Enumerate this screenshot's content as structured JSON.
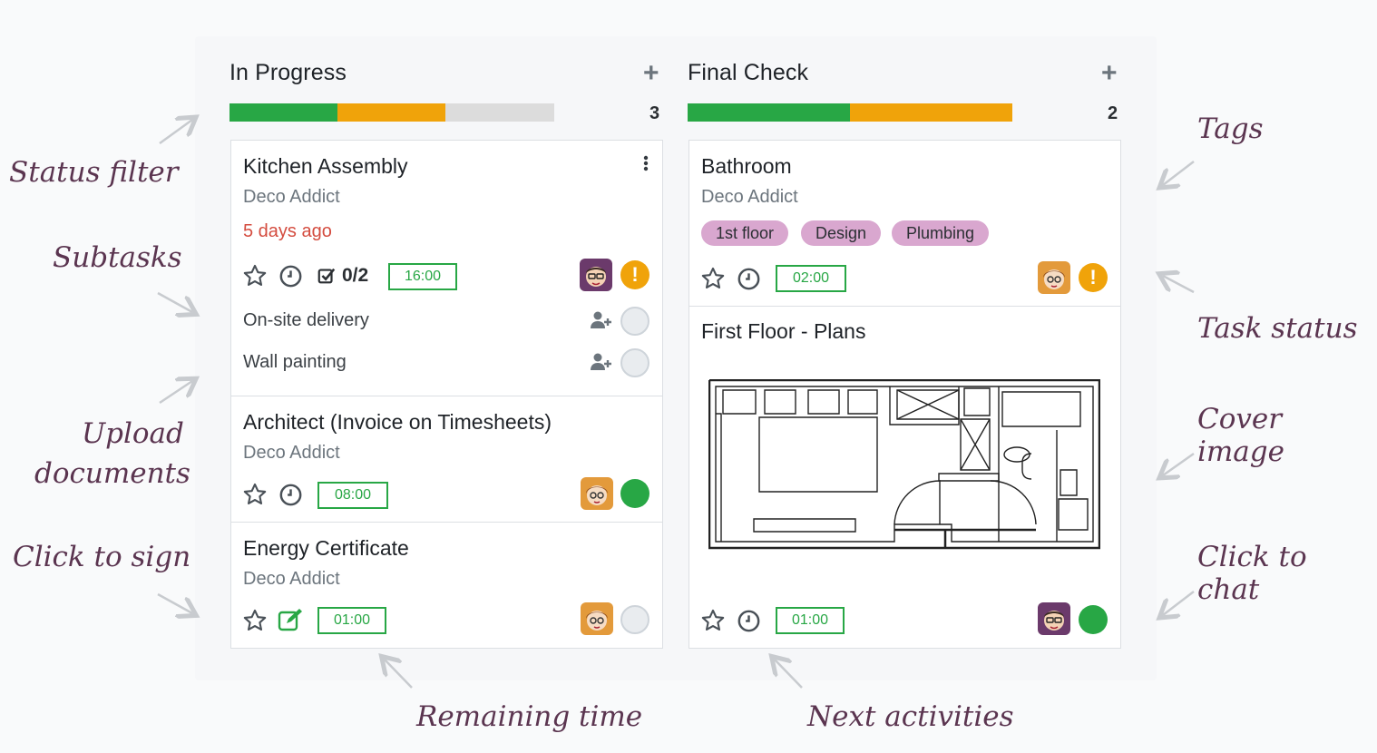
{
  "columns": [
    {
      "title": "In Progress",
      "add_label": "+",
      "count": "3",
      "progress": [
        {
          "color": "#28a745",
          "share": 0.333
        },
        {
          "color": "#f0a30a",
          "share": 0.333
        },
        {
          "color": "#dcdcdc",
          "share": 0.334
        }
      ]
    },
    {
      "title": "Final Check",
      "add_label": "+",
      "count": "2",
      "progress": [
        {
          "color": "#28a745",
          "share": 0.5
        },
        {
          "color": "#f0a30a",
          "share": 0.5
        }
      ]
    }
  ],
  "cards": {
    "kitchen": {
      "title": "Kitchen Assembly",
      "customer": "Deco Addict",
      "deadline": "5 days ago",
      "subtasks_count": "0/2",
      "time": "16:00",
      "status": "warning",
      "subtasks": [
        "On-site delivery",
        "Wall painting"
      ]
    },
    "architect": {
      "title": "Architect (Invoice on Timesheets)",
      "customer": "Deco Addict",
      "time": "08:00",
      "status": "done"
    },
    "energy": {
      "title": "Energy Certificate",
      "customer": "Deco Addict",
      "time": "01:00",
      "status": "normal"
    },
    "bathroom": {
      "title": "Bathroom",
      "customer": "Deco Addict",
      "tags": [
        "1st floor",
        "Design",
        "Plumbing"
      ],
      "time": "02:00",
      "status": "warning"
    },
    "first_floor": {
      "title": "First Floor - Plans",
      "time": "01:00",
      "status": "done"
    }
  },
  "status_symbols": {
    "warning": "!"
  },
  "annotations": {
    "status_filter": "Status filter",
    "subtasks": "Subtasks",
    "upload_documents_line1": "Upload",
    "upload_documents_line2": "documents",
    "click_to_sign": "Click to sign",
    "remaining_time": "Remaining time",
    "next_activities": "Next activities",
    "tags": "Tags",
    "task_status": "Task status",
    "cover_image": "Cover image",
    "click_to_chat": "Click to chat"
  },
  "colors": {
    "done": "#28a745",
    "warning": "#f0a30a",
    "tag": "#d9a7cf",
    "overdue": "#d44c3f",
    "annotation": "#5b3550"
  },
  "icons": [
    "star-icon",
    "clock-icon",
    "checkbox-icon",
    "sign-icon",
    "user-plus-icon",
    "kebab-menu-icon",
    "avatar-icon",
    "arrow-icon"
  ]
}
